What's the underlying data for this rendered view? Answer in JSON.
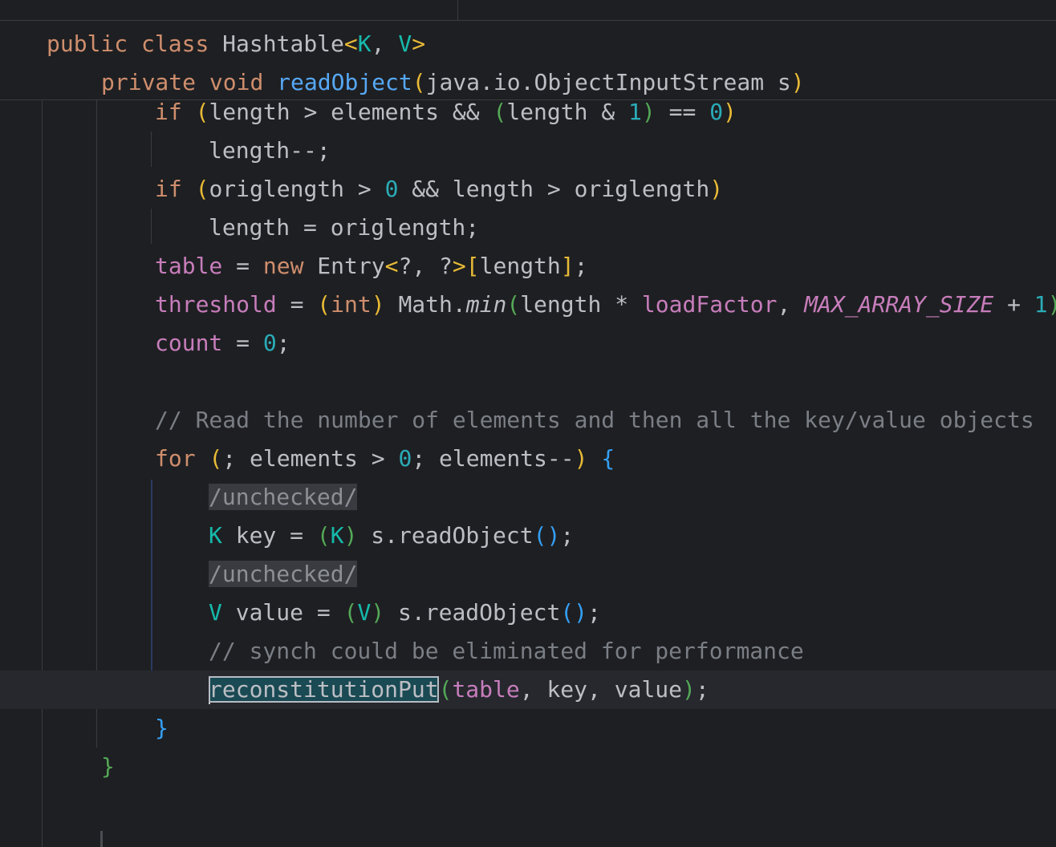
{
  "editor": {
    "sticky": {
      "class_line": {
        "kw1": "public",
        "kw2": "class",
        "name": "Hashtable",
        "lt": "<",
        "k": "K",
        "comma": ", ",
        "v": "V",
        "gt": ">"
      },
      "method_line": {
        "kw1": "private",
        "kw2": "void",
        "name": "readObject",
        "open": "(",
        "param": "java.io.ObjectInputStream s",
        "close": ")"
      }
    },
    "lines": {
      "l1": {
        "kw": "if",
        "o1": "(",
        "a": "length > elements && ",
        "o2": "(",
        "b": "length & ",
        "n1": "1",
        "c2": ")",
        "c": " == ",
        "n2": "0",
        "c1": ")"
      },
      "l2": {
        "text": "length--;"
      },
      "l3": {
        "kw": "if",
        "o1": "(",
        "a": "origlength > ",
        "n": "0",
        "b": " && length > origlength",
        "c1": ")"
      },
      "l4": {
        "text": "length = origlength;"
      },
      "l5": {
        "fld": "table",
        "eq": " = ",
        "kw": "new",
        "sp": " Entry",
        "lt": "<",
        "q": "?, ?",
        "gt": ">",
        "ob": "[",
        "len": "length",
        "cb": "]",
        "semi": ";"
      },
      "l6": {
        "fld": "threshold",
        "eq": " = ",
        "o1": "(",
        "kw": "int",
        "c1": ")",
        "math": " Math.",
        "min": "min",
        "o2": "(",
        "len": "length * ",
        "lf": "loadFactor",
        "comma": ", ",
        "const": "MAX_ARRAY_SIZE",
        "plus": " + ",
        "one": "1",
        "c2": ")"
      },
      "l7": {
        "fld": "count",
        "eq": " = ",
        "n": "0",
        "semi": ";"
      },
      "l9": {
        "comment": "// Read the number of elements and then all the key/value objects"
      },
      "l10": {
        "kw": "for",
        "sp": " ",
        "o1": "(",
        "a": "; elements > ",
        "n": "0",
        "b": "; elements--",
        "c1": ")",
        "sp2": " ",
        "brace": "{"
      },
      "l11": {
        "annot": "/unchecked/"
      },
      "l12": {
        "typ": "K",
        "a": " key = ",
        "o1": "(",
        "k": "K",
        "c1": ")",
        "b": " s.readObject",
        "o2": "()",
        "semi": ";"
      },
      "l13": {
        "annot": "/unchecked/"
      },
      "l14": {
        "typ": "V",
        "a": " value = ",
        "o1": "(",
        "v": "V",
        "c1": ")",
        "b": " s.readObject",
        "o2": "()",
        "semi": ";"
      },
      "l15": {
        "comment": "// synch could be eliminated for performance"
      },
      "l16": {
        "fn": "reconstitutionPut",
        "o1": "(",
        "fld": "table",
        "a": ", key, value",
        "c1": ")",
        "semi": ";"
      },
      "l17": {
        "brace": "}"
      },
      "l18": {
        "brace": "}"
      }
    }
  }
}
